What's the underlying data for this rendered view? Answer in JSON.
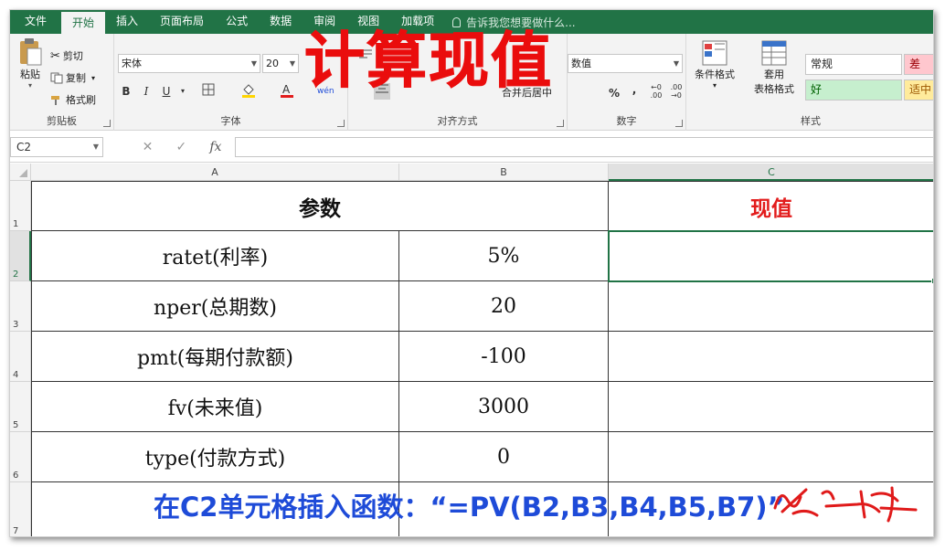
{
  "tabs": [
    "文件",
    "开始",
    "插入",
    "页面布局",
    "公式",
    "数据",
    "审阅",
    "视图",
    "加载项"
  ],
  "active_tab": "开始",
  "tell_me": "告诉我您想要做什么...",
  "ribbon": {
    "clipboard": {
      "paste": "粘贴",
      "cut": "剪切",
      "copy": "复制",
      "format_painter": "格式刷",
      "label": "剪贴板"
    },
    "font": {
      "name": "宋体",
      "size": "20",
      "bold": "B",
      "italic": "I",
      "underline": "U",
      "label": "字体",
      "phonetic": "wén"
    },
    "alignment": {
      "merge": "合并后居中",
      "label": "对齐方式"
    },
    "number": {
      "format": "数值",
      "percent": "%",
      "comma": ",",
      "label": "数字"
    },
    "styles": {
      "conditional": "条件格式",
      "table_fmt_1": "套用",
      "table_fmt_2": "表格格式",
      "normal": "常规",
      "bad": "差",
      "good": "好",
      "neutral": "适中",
      "label": "样式"
    }
  },
  "formula_bar": {
    "name_box": "C2",
    "cancel": "✕",
    "enter": "✓",
    "fx": "fx",
    "value": ""
  },
  "columns": [
    "A",
    "B",
    "C"
  ],
  "selected_column": "C",
  "rows": [
    "1",
    "2",
    "3",
    "4",
    "5",
    "6",
    "7"
  ],
  "selected_row": "2",
  "cells": {
    "header": "参数",
    "pv_header": "现值",
    "r2a": "ratet(利率)",
    "r2b": "5%",
    "r3a": "nper(总期数)",
    "r3b": "20",
    "r4a": "pmt(每期付款额)",
    "r4b": "-100",
    "r5a": "fv(未来值)",
    "r5b": "3000",
    "r6a": "type(付款方式)",
    "r6b": "0"
  },
  "overlay": {
    "title": "计算现值",
    "caption": "在C2单元格插入函数：“=PV(B2,B3,B4,B5,B7)”"
  },
  "colors": {
    "excel_green": "#217346",
    "title_red": "#ea0d0d",
    "caption_blue": "#1e4bd8",
    "pv_red": "#e21c1c"
  }
}
